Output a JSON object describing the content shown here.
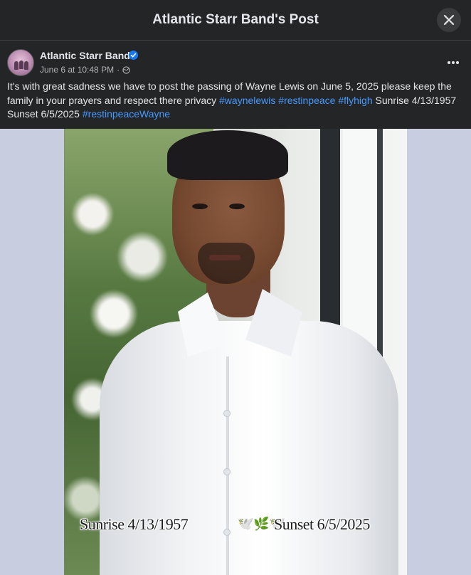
{
  "modal": {
    "title": "Atlantic Starr Band's Post",
    "close_icon": "close-icon"
  },
  "post": {
    "author": "Atlantic Starr Band",
    "verified_icon": "verified-badge-icon",
    "timestamp": "June 6 at 10:48 PM",
    "separator": "·",
    "audience_icon": "globe-icon",
    "more_icon": "more-options-icon",
    "text_parts": [
      {
        "text": "It's with great sadness we have to post the passing of Wayne Lewis on June 5, 2025 please keep the family in your prayers and respect there privacy ",
        "type": "text"
      },
      {
        "text": "#waynelewis",
        "type": "hashtag"
      },
      {
        "text": " ",
        "type": "text"
      },
      {
        "text": "#restinpeace",
        "type": "hashtag"
      },
      {
        "text": " ",
        "type": "text"
      },
      {
        "text": "#flyhigh",
        "type": "hashtag"
      },
      {
        "text": " Sunrise 4/13/1957 Sunset 6/5/2025 ",
        "type": "text"
      },
      {
        "text": "#restinpeaceWayne",
        "type": "hashtag"
      }
    ]
  },
  "photo": {
    "caption_left": "Sunrise 4/13/1957",
    "caption_right": "Sunset 6/5/2025",
    "doves": "🕊️🌿🕊️"
  },
  "colors": {
    "background": "#242526",
    "text": "#e4e6eb",
    "secondary_text": "#b0b3b8",
    "hashtag": "#4599ff",
    "verified": "#1877f2"
  }
}
